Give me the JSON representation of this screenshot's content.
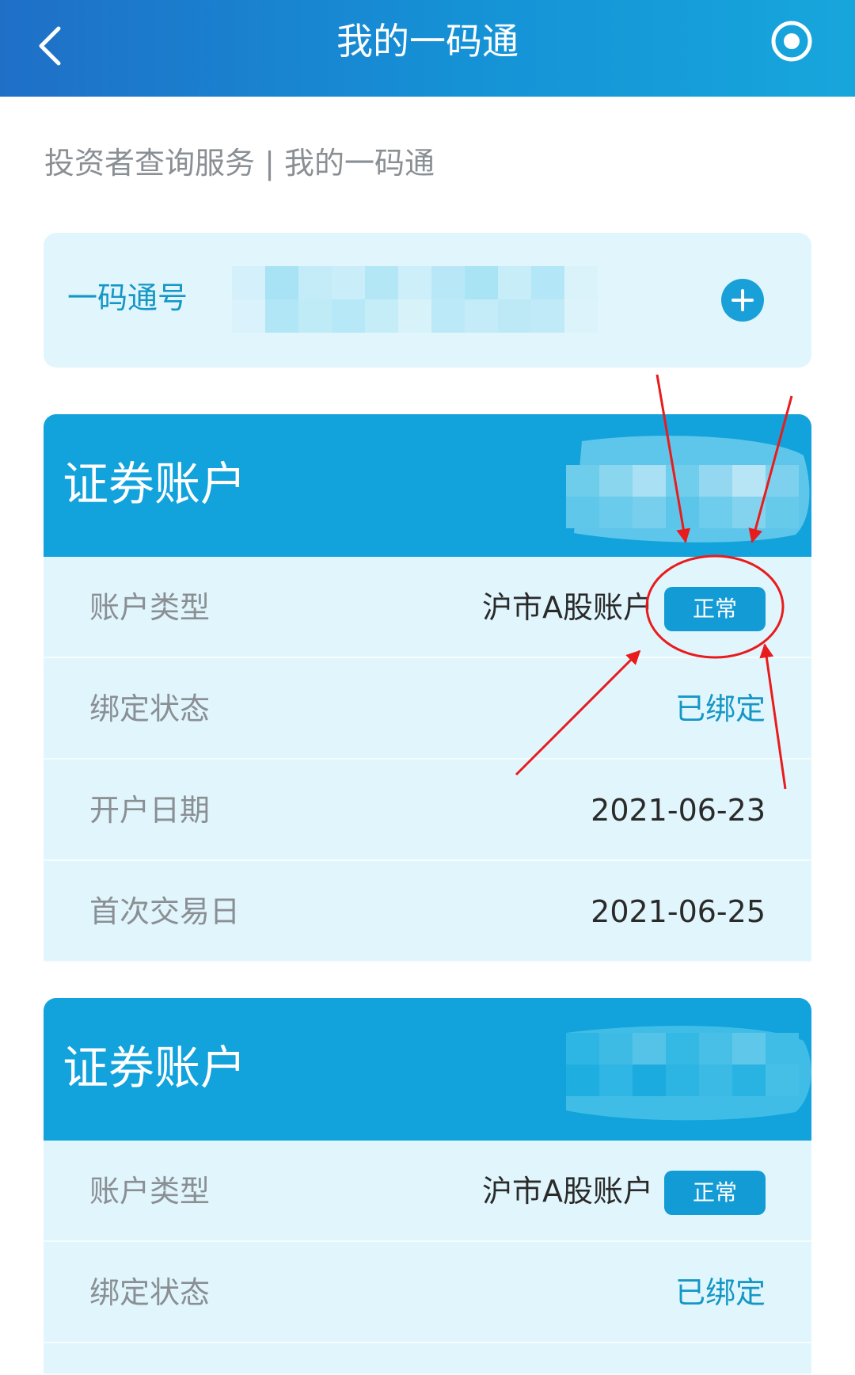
{
  "header": {
    "title": "我的一码通",
    "back_icon": "chevron-left-icon",
    "record_icon": "record-icon"
  },
  "breadcrumb": "投资者查询服务 | 我的一码通",
  "code_card": {
    "label": "一码通号",
    "add_icon": "plus-circle-icon"
  },
  "accounts": [
    {
      "title": "证券账户",
      "rows": {
        "type_label": "账户类型",
        "type_value": "沪市A股账户",
        "status_badge": "正常",
        "bind_label": "绑定状态",
        "bind_value": "已绑定",
        "open_label": "开户日期",
        "open_value": "2021-06-23",
        "first_trade_label": "首次交易日",
        "first_trade_value": "2021-06-25"
      }
    },
    {
      "title": "证券账户",
      "rows": {
        "type_label": "账户类型",
        "type_value": "沪市A股账户",
        "status_badge": "正常",
        "bind_label": "绑定状态",
        "bind_value": "已绑定"
      }
    }
  ],
  "colors": {
    "header_gradient_start": "#1f6fc7",
    "header_gradient_end": "#17a6dc",
    "card_background": "#e1f5fc",
    "account_header": "#12a2dc",
    "accent_text": "#1597c6",
    "annotation": "#e81c1c"
  }
}
